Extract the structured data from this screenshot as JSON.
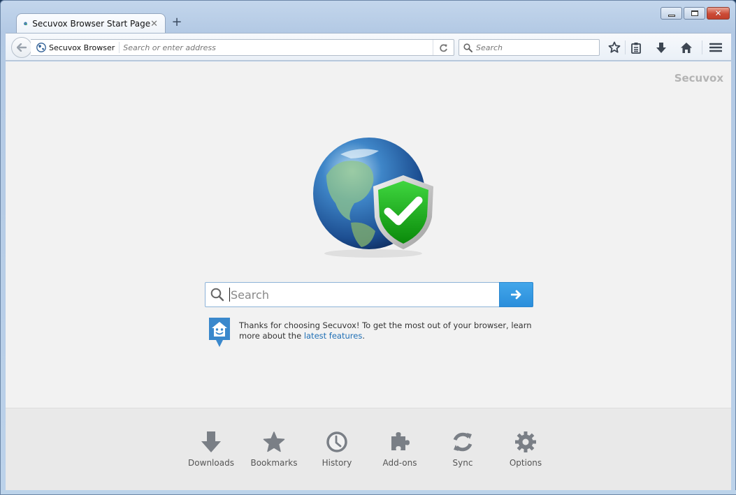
{
  "window": {
    "controls": {
      "minimize": "minimize",
      "maximize": "maximize",
      "close": "close"
    }
  },
  "tabs": [
    {
      "title": "Secuvox Browser Start Page",
      "active": true,
      "icon": "globe-shield-icon"
    }
  ],
  "new_tab_label": "+",
  "toolbar": {
    "identity_label": "Secuvox Browser",
    "address_placeholder": "Search or enter address",
    "address_value": "",
    "search_placeholder": "Search",
    "icons": [
      "back-icon",
      "reload-icon",
      "bookmark-star-icon",
      "reading-list-icon",
      "downloads-icon",
      "home-icon",
      "menu-icon"
    ]
  },
  "content": {
    "brand": "Secuvox",
    "search": {
      "placeholder": "Search",
      "value": "",
      "go_icon": "arrow-right-icon"
    },
    "snippet": {
      "text_before": "Thanks for choosing Secuvox! To get the most out of your browser, learn more about the ",
      "link_text": "latest features",
      "text_after": "."
    }
  },
  "launcher": {
    "items": [
      {
        "label": "Downloads",
        "icon": "download-arrow-icon"
      },
      {
        "label": "Bookmarks",
        "icon": "star-icon"
      },
      {
        "label": "History",
        "icon": "clock-icon"
      },
      {
        "label": "Add-ons",
        "icon": "puzzle-piece-icon"
      },
      {
        "label": "Sync",
        "icon": "sync-icon"
      },
      {
        "label": "Options",
        "icon": "gear-icon"
      }
    ]
  },
  "colors": {
    "accent_blue": "#2a8edb",
    "link": "#1f6fb5",
    "shield_green": "#14a514",
    "close_red": "#cc4b36",
    "icon_gray": "#7a7f86"
  }
}
